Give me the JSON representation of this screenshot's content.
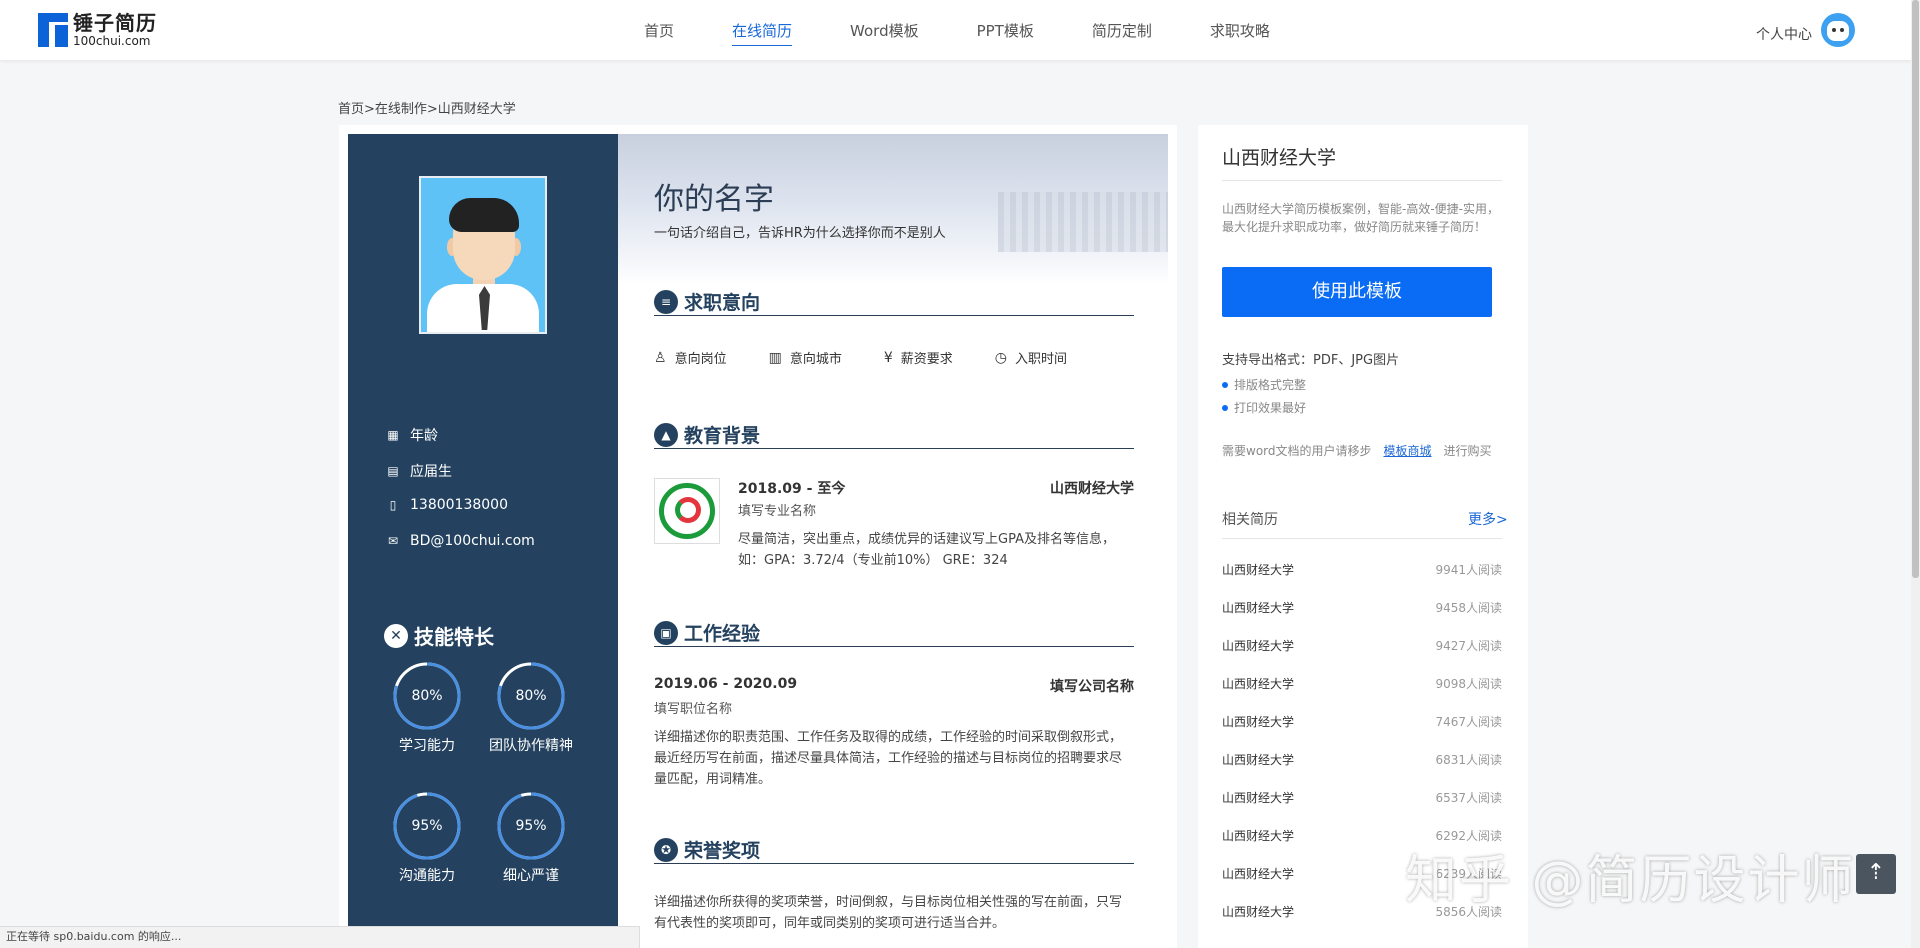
{
  "brand": {
    "name_cn": "锤子简历",
    "domain": "100chui.com"
  },
  "nav": [
    {
      "label": "首页",
      "active": false
    },
    {
      "label": "在线简历",
      "active": true
    },
    {
      "label": "Word模板",
      "active": false
    },
    {
      "label": "PPT模板",
      "active": false
    },
    {
      "label": "简历定制",
      "active": false
    },
    {
      "label": "求职攻略",
      "active": false
    }
  ],
  "user_center": "个人中心",
  "breadcrumb": "首页>在线制作>山西财经大学",
  "resume": {
    "name": "你的名字",
    "intro": "一句话介绍自己，告诉HR为什么选择你而不是别人",
    "personal": {
      "age": "年龄",
      "status": "应届生",
      "phone": "13800138000",
      "email": "BD@100chui.com"
    },
    "skills_title": "技能特长",
    "skills": [
      {
        "name": "学习能力",
        "percent": 80,
        "label": "80%"
      },
      {
        "name": "团队协作精神",
        "percent": 80,
        "label": "80%"
      },
      {
        "name": "沟通能力",
        "percent": 95,
        "label": "95%"
      },
      {
        "name": "细心严谨",
        "percent": 95,
        "label": "95%"
      }
    ],
    "sections": {
      "intent": "求职意向",
      "education": "教育背景",
      "work": "工作经验",
      "honors": "荣誉奖项"
    },
    "intent_items": [
      "意向岗位",
      "意向城市",
      "薪资要求",
      "入职时间"
    ],
    "education": {
      "date": "2018.09 - 至今",
      "school": "山西财经大学",
      "major": "填写专业名称",
      "desc": "尽量简洁，突出重点，成绩优异的话建议写上GPA及排名等信息，如：GPA：3.72/4（专业前10%） GRE：324"
    },
    "work": {
      "date": "2019.06 - 2020.09",
      "company": "填写公司名称",
      "position": "填写职位名称",
      "desc": "详细描述你的职责范围、工作任务及取得的成绩，工作经验的时间采取倒叙形式，最近经历写在前面，描述尽量具体简洁，工作经验的描述与目标岗位的招聘要求尽量匹配，用词精准。"
    },
    "honors": {
      "desc": "详细描述你所获得的奖项荣誉，时间倒叙，与目标岗位相关性强的写在前面，只写有代表性的奖项即可，同年或同类别的奖项可进行适当合并。"
    }
  },
  "panel": {
    "title": "山西财经大学",
    "desc": "山西财经大学简历模板案例，智能-高效-便捷-实用，最大化提升求职成功率，做好简历就来锤子简历！",
    "use_button": "使用此模板",
    "export_formats": "支持导出格式：PDF、JPG图片",
    "features": [
      "排版格式完整",
      "打印效果最好"
    ],
    "word_note_prefix": "需要word文档的用户请移步",
    "word_note_link": "模板商城",
    "word_note_suffix": "进行购买",
    "related_title": "相关简历",
    "related_more": "更多>",
    "related": [
      {
        "name": "山西财经大学",
        "reads": "9941人阅读"
      },
      {
        "name": "山西财经大学",
        "reads": "9458人阅读"
      },
      {
        "name": "山西财经大学",
        "reads": "9427人阅读"
      },
      {
        "name": "山西财经大学",
        "reads": "9098人阅读"
      },
      {
        "name": "山西财经大学",
        "reads": "7467人阅读"
      },
      {
        "name": "山西财经大学",
        "reads": "6831人阅读"
      },
      {
        "name": "山西财经大学",
        "reads": "6537人阅读"
      },
      {
        "name": "山西财经大学",
        "reads": "6292人阅读"
      },
      {
        "name": "山西财经大学",
        "reads": "6239人阅读"
      },
      {
        "name": "山西财经大学",
        "reads": "5856人阅读"
      }
    ]
  },
  "status_bar": "正在等待 sp0.baidu.com 的响应...",
  "watermark": "知乎 @简历设计师",
  "colors": {
    "sidebar": "#24425f",
    "accent": "#0a6cf5",
    "nav_active": "#1769d8"
  },
  "icons": {
    "age": "calendar-icon",
    "status": "document-icon",
    "phone": "phone-icon",
    "email": "mail-icon",
    "skills": "wrench-icon",
    "intent": "clipboard-icon",
    "education": "graduation-cap-icon",
    "work": "briefcase-icon",
    "honors": "medal-icon",
    "back_to_top": "arrow-up-icon"
  }
}
